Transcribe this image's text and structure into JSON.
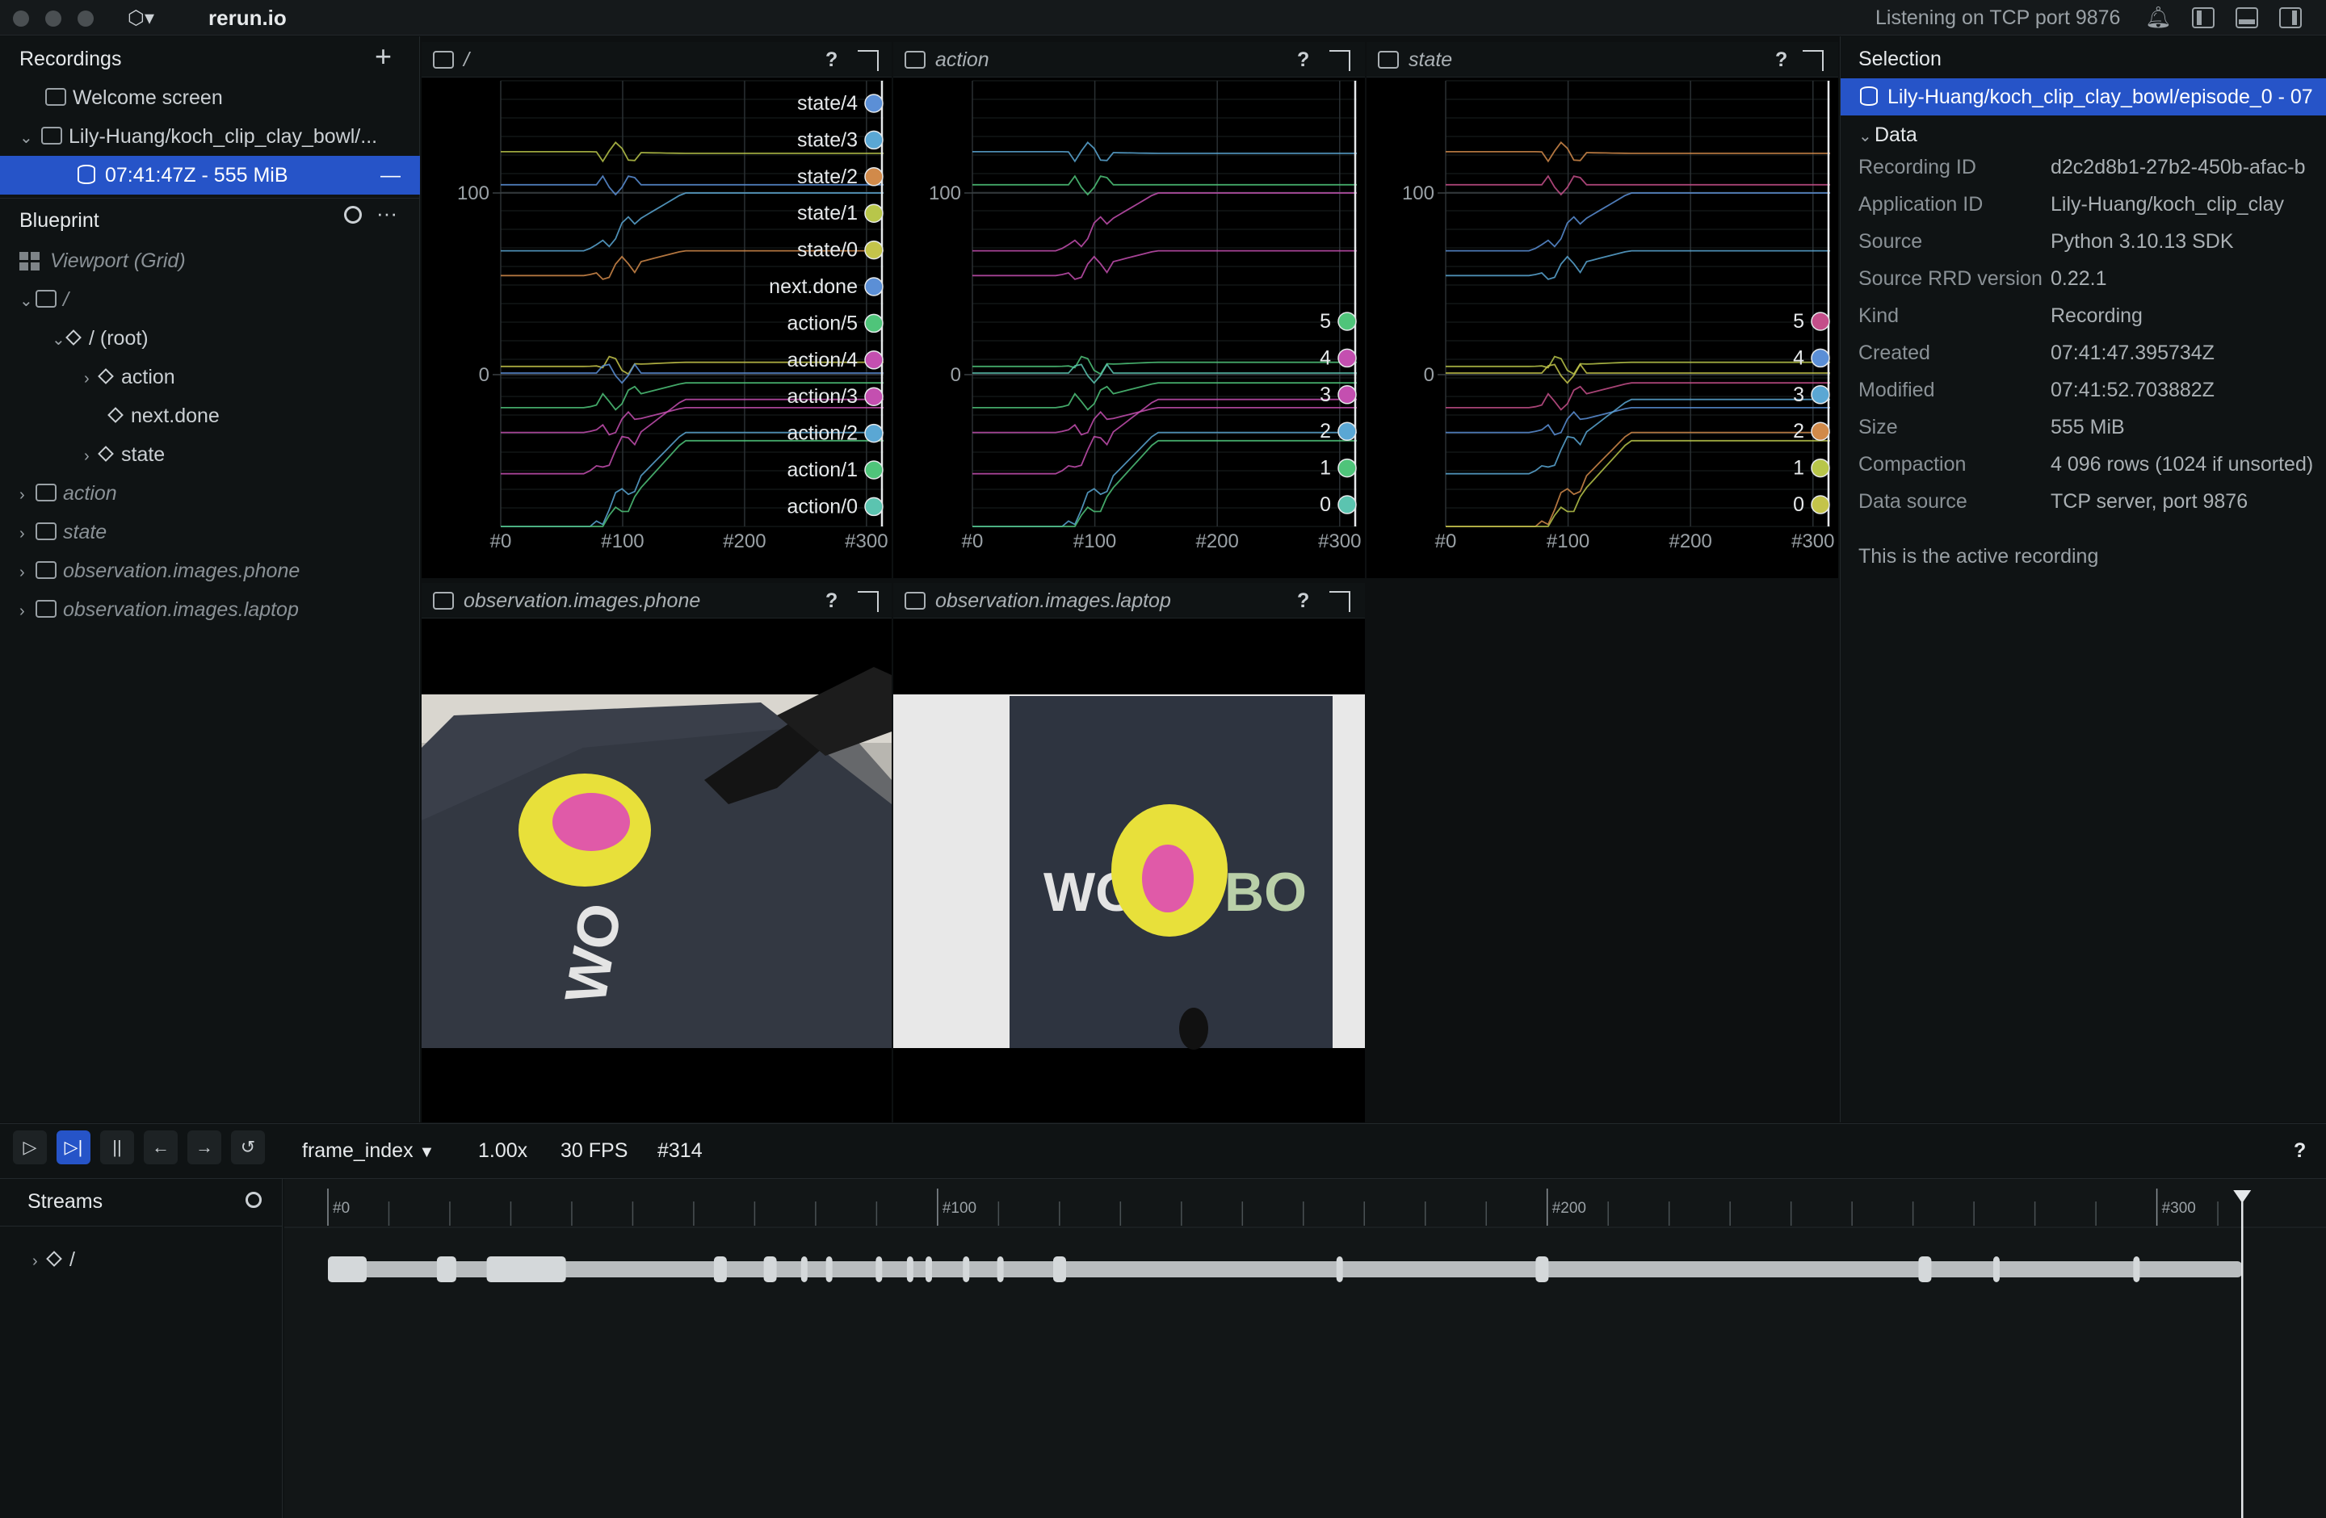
{
  "app": {
    "name": "rerun.io",
    "status": "Listening on TCP port 9876"
  },
  "recordings": {
    "header": "Recordings",
    "items": [
      {
        "label": "Welcome screen"
      },
      {
        "label": "Lily-Huang/koch_clip_clay_bowl/..."
      },
      {
        "label": "07:41:47Z - 555 MiB"
      }
    ]
  },
  "blueprint": {
    "header": "Blueprint",
    "items": [
      {
        "label": "Viewport (Grid)"
      },
      {
        "label": "/"
      },
      {
        "label": "/ (root)"
      },
      {
        "label": "action"
      },
      {
        "label": "next.done"
      },
      {
        "label": "state"
      },
      {
        "label": "action"
      },
      {
        "label": "state"
      },
      {
        "label": "observation.images.phone"
      },
      {
        "label": "observation.images.laptop"
      }
    ]
  },
  "views": {
    "root": {
      "title": "/",
      "help": "?"
    },
    "action": {
      "title": "action",
      "help": "?"
    },
    "state": {
      "title": "state",
      "help": "?"
    },
    "phone": {
      "title": "observation.images.phone",
      "help": "?"
    },
    "laptop": {
      "title": "observation.images.laptop",
      "help": "?"
    }
  },
  "chart_data": [
    {
      "type": "line",
      "view": "/",
      "x_ticks": [
        "#0",
        "#100",
        "#200",
        "#300"
      ],
      "y_ticks": [
        "100",
        "0"
      ],
      "xlim": [
        0,
        314
      ],
      "legend": [
        "state/4",
        "state/3",
        "state/2",
        "state/1",
        "state/0",
        "next.done",
        "action/5",
        "action/4",
        "action/3",
        "action/2",
        "action/1",
        "action/0"
      ],
      "legend_colors": [
        "#5b8fd6",
        "#5aa7d4",
        "#d18a4a",
        "#b8c64a",
        "#c4c44a",
        "#5b8fd6",
        "#4fc47a",
        "#c44fb0",
        "#c44fb0",
        "#5aa7d4",
        "#4fc47a",
        "#5bc4b0"
      ]
    },
    {
      "type": "line",
      "view": "action",
      "x_ticks": [
        "#0",
        "#100",
        "#200",
        "#300"
      ],
      "y_ticks": [
        "100",
        "0"
      ],
      "xlim": [
        0,
        314
      ],
      "legend": [
        "5",
        "4",
        "3",
        "2",
        "1",
        "0"
      ],
      "legend_colors": [
        "#4fc47a",
        "#c44fb0",
        "#c44fb0",
        "#5aa7d4",
        "#4fc47a",
        "#5bc4b0"
      ]
    },
    {
      "type": "line",
      "view": "state",
      "x_ticks": [
        "#0",
        "#100",
        "#200",
        "#300"
      ],
      "y_ticks": [
        "100",
        "0"
      ],
      "xlim": [
        0,
        314
      ],
      "legend": [
        "5",
        "4",
        "3",
        "2",
        "1",
        "0"
      ],
      "legend_colors": [
        "#c44f8a",
        "#5b8fd6",
        "#5aa7d4",
        "#d18a4a",
        "#b8c64a",
        "#c4c44a"
      ]
    }
  ],
  "selection": {
    "header": "Selection",
    "selected": "Lily-Huang/koch_clip_clay_bowl/episode_0 - 07",
    "section": "Data",
    "rows": [
      {
        "key": "Recording ID",
        "value": "d2c2d8b1-27b2-450b-afac-b"
      },
      {
        "key": "Application ID",
        "value": "Lily-Huang/koch_clip_clay"
      },
      {
        "key": "Source",
        "value": "Python 3.10.13 SDK"
      },
      {
        "key": "Source RRD version",
        "value": "0.22.1"
      },
      {
        "key": "Kind",
        "value": "Recording"
      },
      {
        "key": "Created",
        "value": "07:41:47.395734Z"
      },
      {
        "key": "Modified",
        "value": "07:41:52.703882Z"
      },
      {
        "key": "Size",
        "value": "555 MiB"
      },
      {
        "key": "Compaction",
        "value": "4 096 rows (1024 if unsorted)"
      },
      {
        "key": "Data source",
        "value": "TCP server, port 9876"
      }
    ],
    "note": "This is the active recording"
  },
  "timeline": {
    "timeline_name": "frame_index",
    "speed": "1.00x",
    "fps": "30 FPS",
    "current_frame": "#314",
    "help": "?",
    "ticks": [
      "#0",
      "#100",
      "#200",
      "#300"
    ],
    "streams_header": "Streams",
    "streams_root": "/"
  }
}
